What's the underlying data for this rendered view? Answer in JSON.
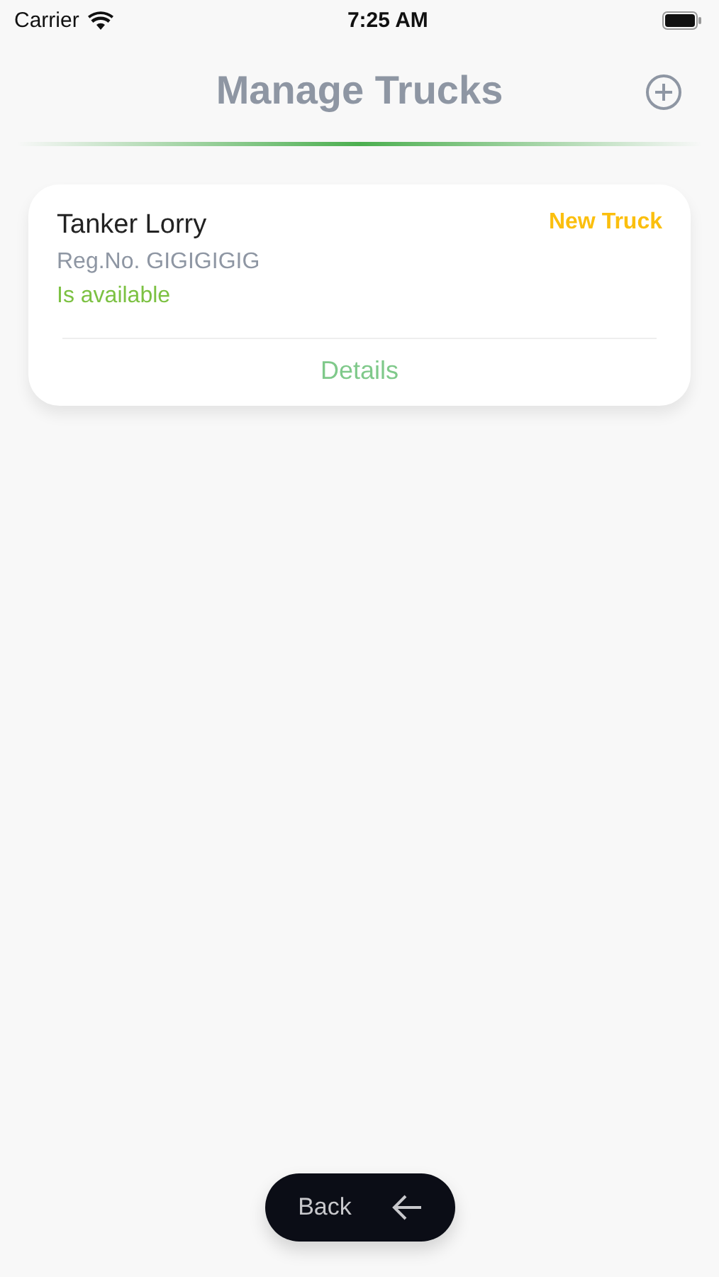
{
  "status_bar": {
    "carrier": "Carrier",
    "time": "7:25 AM"
  },
  "header": {
    "title": "Manage Trucks"
  },
  "trucks": [
    {
      "name": "Tanker Lorry",
      "badge": "New Truck",
      "reg": "Reg.No. GIGIGIGIG",
      "availability": "Is available",
      "available": true,
      "action": "Details"
    }
  ],
  "back_button": {
    "label": "Back"
  }
}
